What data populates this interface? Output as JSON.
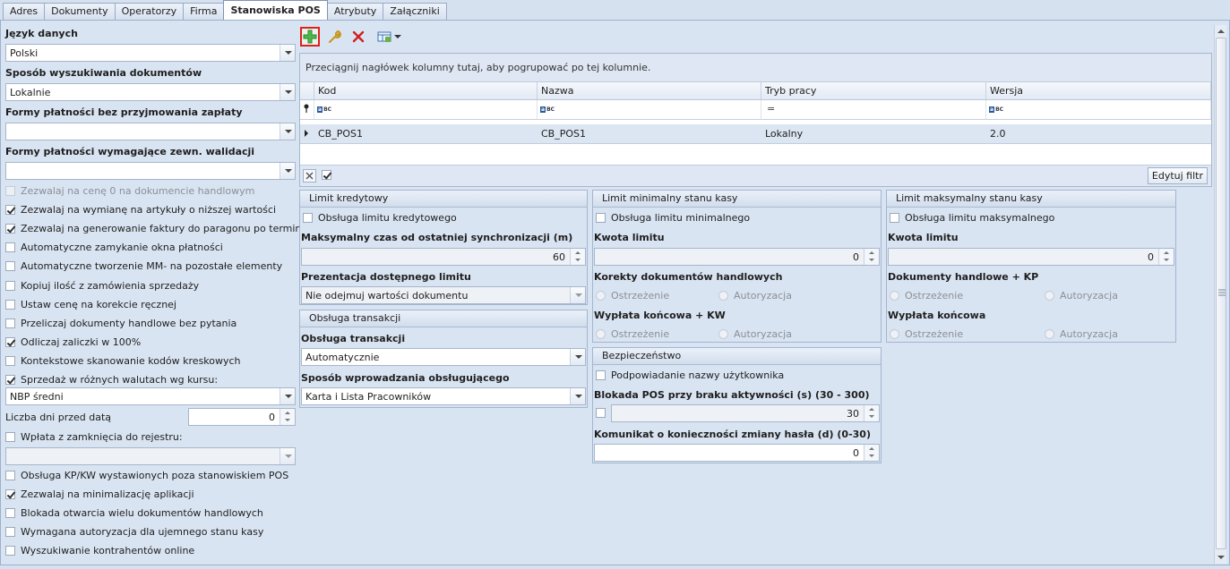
{
  "tabs": [
    "Adres",
    "Dokumenty",
    "Operatorzy",
    "Firma",
    "Stanowiska POS",
    "Atrybuty",
    "Załączniki"
  ],
  "active_tab": "Stanowiska POS",
  "left": {
    "jezyk_label": "Język danych",
    "jezyk_value": "Polski",
    "sposob_label": "Sposób wyszukiwania dokumentów",
    "sposob_value": "Lokalnie",
    "formy_bez_label": "Formy płatności bez przyjmowania zapłaty",
    "formy_bez_value": "",
    "formy_wym_label": "Formy płatności wymagające zewn. walidacji",
    "formy_wym_value": "",
    "checks": [
      {
        "label": "Zezwalaj na cenę 0 na dokumencie handlowym",
        "checked": false,
        "disabled": true
      },
      {
        "label": "Zezwalaj na wymianę na artykuły o niższej wartości",
        "checked": true,
        "disabled": false
      },
      {
        "label": "Zezwalaj na generowanie faktury do paragonu po terminie",
        "checked": true,
        "disabled": false
      },
      {
        "label": "Automatyczne zamykanie okna płatności",
        "checked": false,
        "disabled": false
      },
      {
        "label": "Automatyczne tworzenie MM- na pozostałe elementy",
        "checked": false,
        "disabled": false
      },
      {
        "label": "Kopiuj ilość z zamówienia sprzedaży",
        "checked": false,
        "disabled": false
      },
      {
        "label": "Ustaw cenę na korekcie ręcznej",
        "checked": false,
        "disabled": false
      },
      {
        "label": "Przeliczaj dokumenty handlowe bez pytania",
        "checked": false,
        "disabled": false
      },
      {
        "label": "Odliczaj zaliczki w 100%",
        "checked": true,
        "disabled": false
      },
      {
        "label": "Kontekstowe skanowanie kodów kreskowych",
        "checked": false,
        "disabled": false
      },
      {
        "label": "Sprzedaż w różnych walutach wg kursu:",
        "checked": true,
        "disabled": false
      }
    ],
    "kurs_value": "NBP średni",
    "liczba_dni_label": "Liczba dni przed datą",
    "liczba_dni_value": "0",
    "wplata_label": "Wpłata z zamknięcia do rejestru:",
    "wplata_value": "",
    "checks2": [
      {
        "label": "Obsługa KP/KW wystawionych poza stanowiskiem POS",
        "checked": false
      },
      {
        "label": "Zezwalaj na minimalizację aplikacji",
        "checked": true
      },
      {
        "label": "Blokada otwarcia wielu dokumentów handlowych",
        "checked": false
      },
      {
        "label": "Wymagana autoryzacja dla ujemnego stanu kasy",
        "checked": false
      },
      {
        "label": "Wyszukiwanie kontrahentów online",
        "checked": false
      }
    ]
  },
  "grid": {
    "group_hint": "Przeciągnij nagłówek kolumny tutaj, aby pogrupować po tej kolumnie.",
    "columns": [
      "Kod",
      "Nazwa",
      "Tryb pracy",
      "Wersja"
    ],
    "filter_equals": "=",
    "rows": [
      [
        "CB_POS1",
        "CB_POS1",
        "Lokalny",
        "2.0"
      ]
    ],
    "edit_filter": "Edytuj filtr"
  },
  "limit_kredytowy": {
    "title": "Limit kredytowy",
    "check": "Obsługa limitu kredytowego",
    "czas_label": "Maksymalny czas od ostatniej synchronizacji (m)",
    "czas_value": "60",
    "prezentacja_label": "Prezentacja dostępnego limitu",
    "prezentacja_value": "Nie odejmuj wartości dokumentu"
  },
  "obsluga_transakcji": {
    "title": "Obsługa transakcji",
    "label": "Obsługa transakcji",
    "value": "Automatycznie",
    "sposob_label": "Sposób wprowadzania obsługującego",
    "sposob_value": "Karta i Lista Pracowników"
  },
  "limit_min": {
    "title": "Limit minimalny stanu kasy",
    "check": "Obsługa limitu minimalnego",
    "kwota_label": "Kwota limitu",
    "kwota_value": "0",
    "korekty_label": "Korekty dokumentów handlowych",
    "r1": "Ostrzeżenie",
    "r2": "Autoryzacja",
    "wyplata_label": "Wypłata końcowa + KW"
  },
  "limit_max": {
    "title": "Limit maksymalny stanu kasy",
    "check": "Obsługa limitu maksymalnego",
    "kwota_label": "Kwota limitu",
    "kwota_value": "0",
    "dok_label": "Dokumenty handlowe + KP",
    "r1": "Ostrzeżenie",
    "r2": "Autoryzacja",
    "wyplata_label": "Wypłata końcowa"
  },
  "bezpieczenstwo": {
    "title": "Bezpieczeństwo",
    "check": "Podpowiadanie nazwy użytkownika",
    "blokada_label": "Blokada POS przy braku aktywności (s) (30 - 300)",
    "blokada_value": "30",
    "komunikat_label": "Komunikat o konieczności zmiany hasła (d) (0-30)",
    "komunikat_value": "0"
  },
  "colors": {
    "accent": "#2a5b9c",
    "add_green": "#2e9e2e",
    "delete_red": "#d02020",
    "highlight": "#e02020"
  }
}
